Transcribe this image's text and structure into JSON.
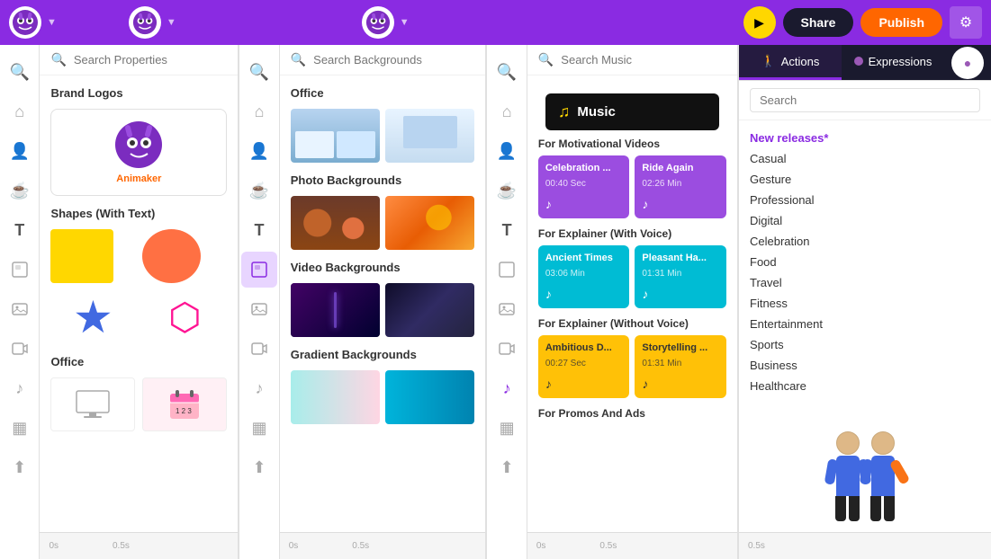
{
  "topbar": {
    "play_label": "▶",
    "share_label": "Share",
    "publish_label": "Publish",
    "settings_icon": "⚙"
  },
  "properties_panel": {
    "search_placeholder": "Search Properties",
    "sections": [
      {
        "title": "Brand Logos"
      },
      {
        "title": "Shapes (With Text)"
      },
      {
        "title": "Office"
      }
    ]
  },
  "backgrounds_panel": {
    "search_placeholder": "Search Backgrounds",
    "sections": [
      {
        "title": "Office"
      },
      {
        "title": "Photo Backgrounds"
      },
      {
        "title": "Video Backgrounds"
      },
      {
        "title": "Gradient Backgrounds"
      }
    ]
  },
  "music_panel": {
    "search_placeholder": "Search Music",
    "header_label": "Music",
    "categories": [
      {
        "title": "For Motivational Videos",
        "cards": [
          {
            "name": "Celebration ...",
            "duration": "00:40 Sec",
            "color": "purple"
          },
          {
            "name": "Ride Again",
            "duration": "02:26 Min",
            "color": "purple"
          }
        ]
      },
      {
        "title": "For Explainer (With Voice)",
        "cards": [
          {
            "name": "Ancient Times",
            "duration": "03:06 Min",
            "color": "teal"
          },
          {
            "name": "Pleasant Ha...",
            "duration": "01:31 Min",
            "color": "teal"
          }
        ]
      },
      {
        "title": "For Explainer (Without Voice)",
        "cards": [
          {
            "name": "Ambitious D...",
            "duration": "00:27 Sec",
            "color": "yellow"
          },
          {
            "name": "Storytelling ...",
            "duration": "01:31 Min",
            "color": "yellow"
          }
        ]
      },
      {
        "title": "For Promos And Ads",
        "cards": []
      }
    ]
  },
  "right_panel": {
    "tabs": [
      {
        "label": "Actions",
        "icon": "🚶",
        "active": true
      },
      {
        "label": "Expressions",
        "icon": "😊",
        "active": false
      }
    ],
    "search_placeholder": "Search",
    "categories": [
      {
        "label": "New releases*",
        "class": "new-releases"
      },
      {
        "label": "Casual"
      },
      {
        "label": "Gesture"
      },
      {
        "label": "Professional"
      },
      {
        "label": "Digital"
      },
      {
        "label": "Celebration"
      },
      {
        "label": "Food"
      },
      {
        "label": "Travel"
      },
      {
        "label": "Fitness"
      },
      {
        "label": "Entertainment"
      },
      {
        "label": "Sports"
      },
      {
        "label": "Business"
      },
      {
        "label": "Healthcare"
      }
    ]
  },
  "timeline": {
    "left_time": "0s",
    "mid_time": "0.5s",
    "right_time": "0.5s"
  },
  "icons": {
    "search": "🔍",
    "home": "🏠",
    "character": "👤",
    "text": "T",
    "background": "🖼",
    "shape": "◻",
    "upload": "⬆",
    "music": "♪",
    "plus": "+",
    "settings": "⚙",
    "grid": "▦",
    "image": "🖼",
    "calendar": "📅",
    "monitor": "🖥",
    "coffee": "☕"
  }
}
